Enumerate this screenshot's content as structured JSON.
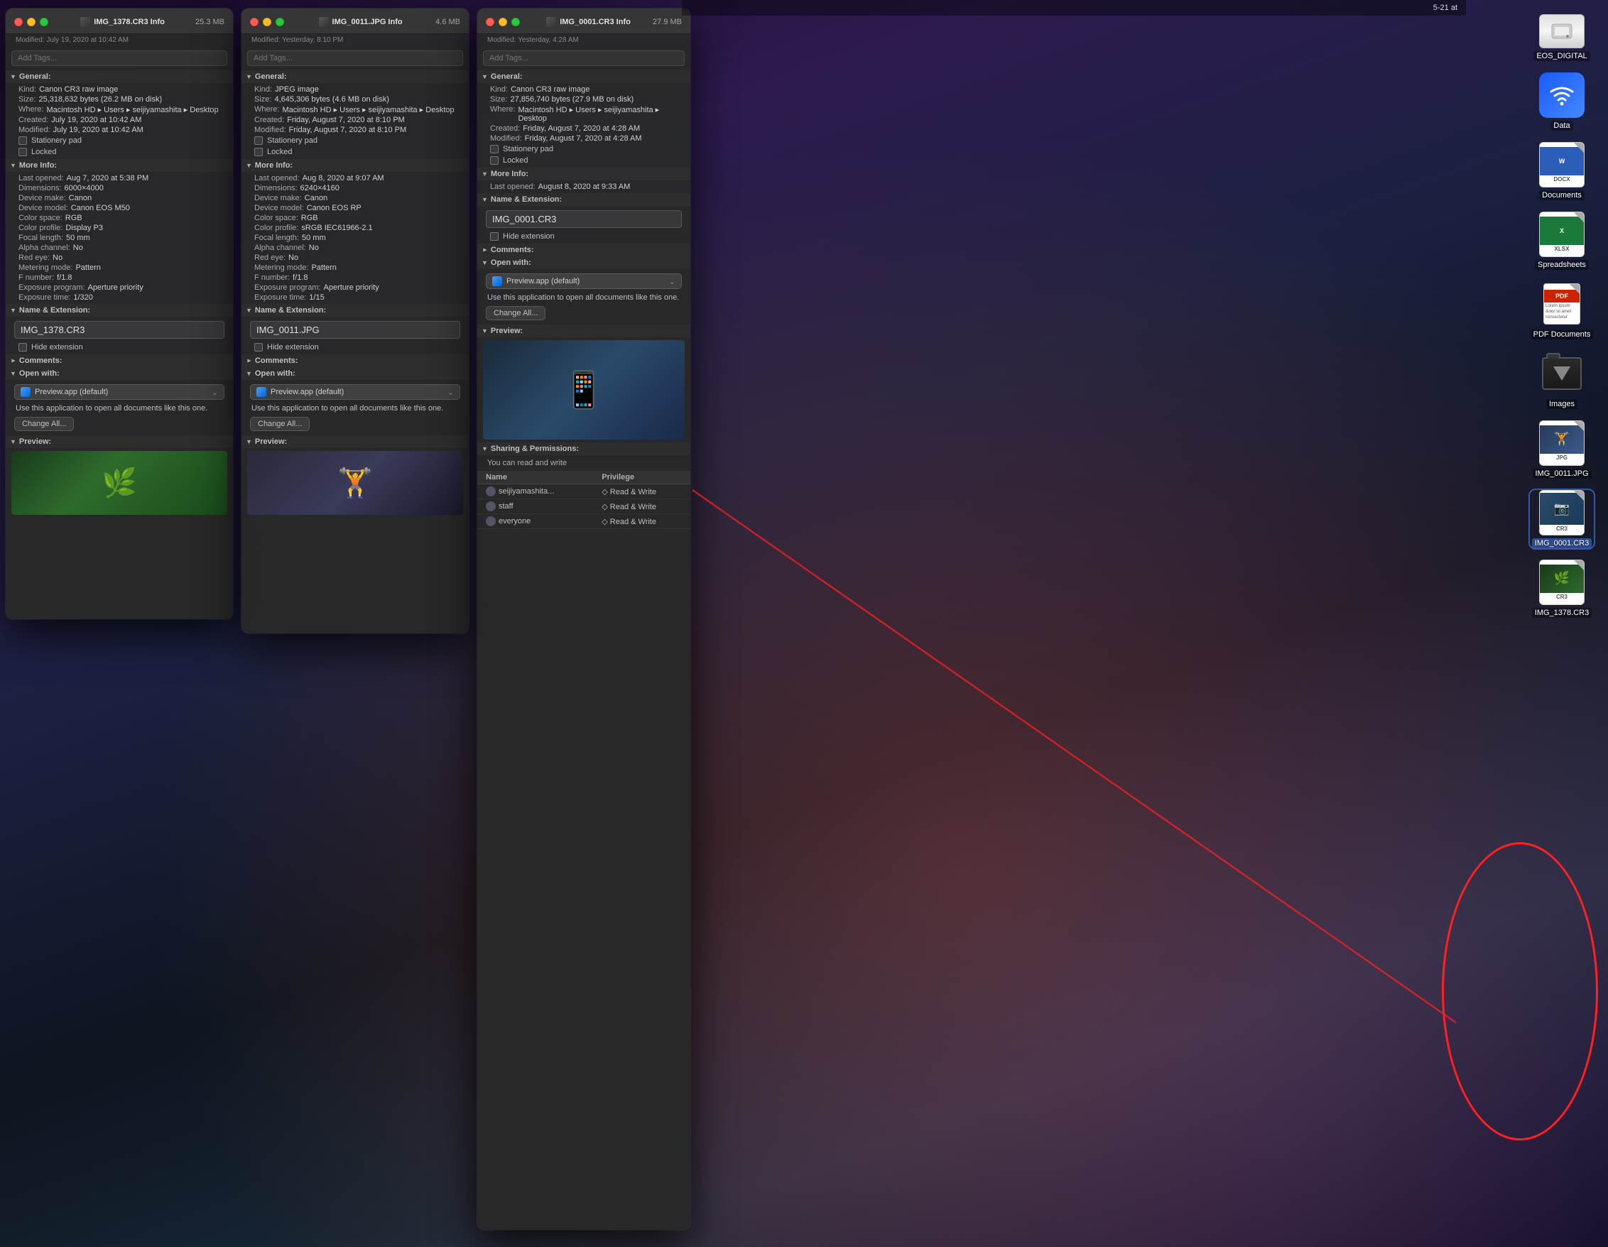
{
  "desktop": {
    "background": "city skyline sunset",
    "icons": [
      {
        "id": "eos-digital",
        "label": "EOS_DIGITAL",
        "type": "drive"
      },
      {
        "id": "data",
        "label": "Data",
        "type": "wifi"
      },
      {
        "id": "documents",
        "label": "Documents",
        "type": "docx"
      },
      {
        "id": "spreadsheets",
        "label": "Spreadsheets",
        "type": "xlsx"
      },
      {
        "id": "pdf-documents",
        "label": "PDF Documents",
        "type": "pdf"
      },
      {
        "id": "images",
        "label": "Images",
        "type": "folder-dark"
      },
      {
        "id": "img-0011",
        "label": "IMG_0011.JPG",
        "type": "jpg-thumb"
      },
      {
        "id": "img-0001",
        "label": "IMG_0001.CR3",
        "type": "cr3-thumb"
      },
      {
        "id": "img-1378",
        "label": "IMG_1378.CR3",
        "type": "cr3-thumb2"
      }
    ]
  },
  "window1": {
    "title": "IMG_1378.CR3 Info",
    "filename": "IMG_1378.CR3",
    "filesize": "25.3 MB",
    "modified": "Modified: July 19, 2020 at 10:42 AM",
    "tags_placeholder": "Add Tags...",
    "general": {
      "label": "General:",
      "kind": "Canon CR3 raw image",
      "size_bytes": "25,318,632 bytes (26.2 MB on disk)",
      "where": "Macintosh HD ▸ Users ▸ seijiyamashita ▸ Desktop",
      "created": "July 19, 2020 at 10:42 AM",
      "modified": "July 19, 2020 at 10:42 AM",
      "stationery_pad": "Stationery pad",
      "locked": "Locked"
    },
    "more_info": {
      "label": "More Info:",
      "last_opened": "Aug 7, 2020 at 5:38 PM",
      "dimensions": "6000×4000",
      "device_make": "Canon",
      "device_model": "Canon EOS M50",
      "color_space": "RGB",
      "color_profile": "Display P3",
      "focal_length": "50 mm",
      "alpha_channel": "No",
      "red_eye": "No",
      "metering_mode": "Pattern",
      "f_number": "f/1.8",
      "exposure_program": "Aperture priority",
      "exposure_time": "1/320"
    },
    "name_extension": {
      "label": "Name & Extension:",
      "name": "IMG_1378.CR3",
      "hide_extension": "Hide extension"
    },
    "comments": {
      "label": "Comments:"
    },
    "open_with": {
      "label": "Open with:",
      "app": "Preview.app (default)",
      "use_text": "Use this application to open all documents like this one.",
      "change_all": "Change All..."
    },
    "preview": {
      "label": "Preview:"
    }
  },
  "window2": {
    "title": "IMG_0011.JPG Info",
    "filename": "IMG_0011.JPG",
    "filesize": "4.6 MB",
    "modified": "Modified: Yesterday, 8:10 PM",
    "tags_placeholder": "Add Tags...",
    "general": {
      "label": "General:",
      "kind": "JPEG image",
      "size_bytes": "4,645,306 bytes (4.6 MB on disk)",
      "where": "Macintosh HD ▸ Users ▸ seijiyamashita ▸ Desktop",
      "created": "Friday, August 7, 2020 at 8:10 PM",
      "modified": "Friday, August 7, 2020 at 8:10 PM",
      "stationery_pad": "Stationery pad",
      "locked": "Locked"
    },
    "more_info": {
      "label": "More Info:",
      "last_opened": "Aug 8, 2020 at 9:07 AM",
      "dimensions": "6240×4160",
      "device_make": "Canon",
      "device_model": "Canon EOS RP",
      "color_space": "RGB",
      "color_profile": "sRGB IEC61966-2.1",
      "focal_length": "50 mm",
      "alpha_channel": "No",
      "red_eye": "No",
      "metering_mode": "Pattern",
      "f_number": "f/1.8",
      "exposure_program": "Aperture priority",
      "exposure_time": "1/15"
    },
    "name_extension": {
      "label": "Name & Extension:",
      "name": "IMG_0011.JPG",
      "hide_extension": "Hide extension"
    },
    "comments": {
      "label": "Comments:"
    },
    "open_with": {
      "label": "Open with:",
      "app": "Preview.app (default)",
      "use_text": "Use this application to open all documents like this one.",
      "change_all": "Change All..."
    },
    "preview": {
      "label": "Preview:"
    }
  },
  "window3": {
    "title": "IMG_0001.CR3 Info",
    "filename": "IMG_0001.CR3",
    "filesize": "27.9 MB",
    "modified": "Modified: Yesterday, 4:28 AM",
    "tags_placeholder": "Add Tags...",
    "general": {
      "label": "General:",
      "kind": "Canon CR3 raw image",
      "size_bytes": "27,856,740 bytes (27.9 MB on disk)",
      "where": "Macintosh HD ▸ Users ▸ seijiyamashita ▸ Desktop",
      "created": "Friday, August 7, 2020 at 4:28 AM",
      "modified": "Friday, August 7, 2020 at 4:28 AM",
      "stationery_pad": "Stationery pad",
      "locked": "Locked"
    },
    "more_info": {
      "label": "More Info:",
      "last_opened": "August 8, 2020 at 9:33 AM"
    },
    "name_extension": {
      "label": "Name & Extension:",
      "name": "IMG_0001.CR3",
      "hide_extension": "Hide extension"
    },
    "comments": {
      "label": "Comments:"
    },
    "open_with": {
      "label": "Open with:",
      "app": "Preview.app (default)",
      "use_text": "Use this application to open all documents like this one.",
      "change_all": "Change All..."
    },
    "preview": {
      "label": "Preview:"
    },
    "sharing": {
      "label": "Sharing & Permissions:",
      "description": "You can read and write",
      "columns": [
        "Name",
        "Privilege"
      ],
      "rows": [
        {
          "name": "seijiyamashita...",
          "privilege": "◇ Read & Write",
          "icon": "user"
        },
        {
          "name": "staff",
          "privilege": "◇ Read & Write",
          "icon": "group"
        },
        {
          "name": "everyone",
          "privilege": "◇ Read & Write",
          "icon": "group"
        }
      ]
    }
  },
  "topbar": {
    "datetime": "5-21 at"
  }
}
